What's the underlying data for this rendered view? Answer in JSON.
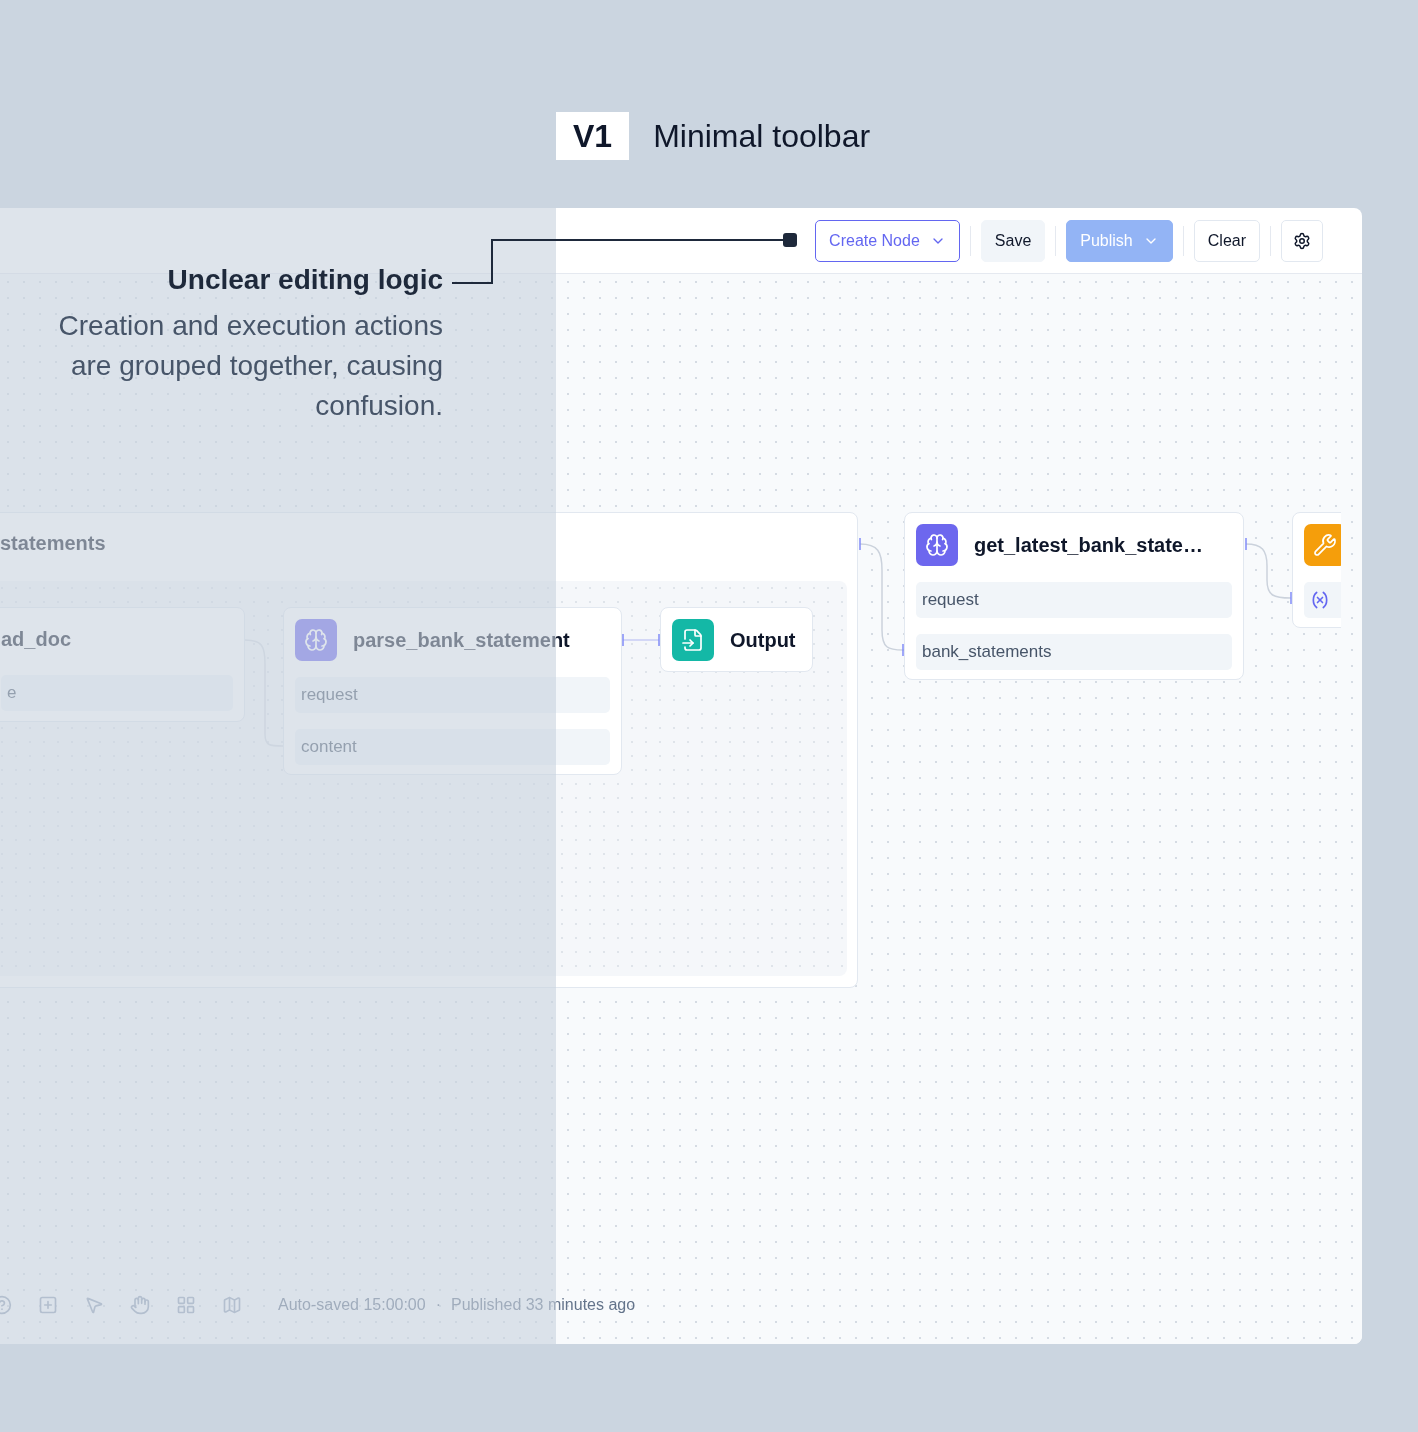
{
  "header": {
    "version": "V1",
    "title": "Minimal toolbar"
  },
  "annotation": {
    "title": "Unclear editing logic",
    "body": "Creation and execution actions are grouped together, causing confusion."
  },
  "toolbar": {
    "buttons": [
      {
        "kind": "outline",
        "label": "Create Node",
        "dropdown": true
      },
      {
        "kind": "soft",
        "label": "Save",
        "dropdown": false
      },
      {
        "kind": "primary",
        "label": "Publish",
        "dropdown": true
      },
      {
        "kind": "plain",
        "label": "Clear",
        "dropdown": false
      },
      {
        "kind": "settings",
        "dropdown": false
      }
    ]
  },
  "canvas": {
    "group_title": "statements",
    "nodes": [
      {
        "kind": "plain",
        "title": "ad_doc",
        "fields": [
          {
            "kind": "text",
            "label": "e"
          }
        ]
      },
      {
        "kind": "llm",
        "title": "parse_bank_statement",
        "fields": [
          {
            "kind": "text",
            "label": "request"
          },
          {
            "kind": "text",
            "label": "content"
          }
        ]
      },
      {
        "kind": "output",
        "title": "Output"
      },
      {
        "kind": "llm",
        "title": "get_latest_bank_state…",
        "fields": [
          {
            "kind": "text",
            "label": "request"
          },
          {
            "kind": "text",
            "label": "bank_statements"
          }
        ]
      },
      {
        "kind": "tool",
        "fields": [
          {
            "kind": "variable"
          }
        ]
      }
    ]
  },
  "status_bar": {
    "autosave": "Auto-saved 15:00:00",
    "separator": "·",
    "published": "Published 33 minutes ago"
  }
}
